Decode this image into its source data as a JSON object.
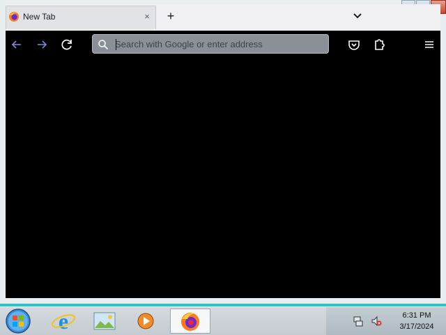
{
  "browser": {
    "tab": {
      "title": "New Tab",
      "close_glyph": "×"
    },
    "new_tab_glyph": "+",
    "address_bar": {
      "placeholder": "Search with Google or enter address",
      "value": ""
    },
    "icons": {
      "favicon": "firefox-icon",
      "back": "back-arrow-icon",
      "forward": "forward-arrow-icon",
      "reload": "reload-icon",
      "search": "search-icon",
      "pocket": "pocket-icon",
      "extensions": "puzzle-icon",
      "menu": "hamburger-menu-icon",
      "tab_list": "chevron-down-icon"
    }
  },
  "window_controls": [
    "minimize",
    "maximize",
    "close"
  ],
  "taskbar": {
    "start": "windows-start-icon",
    "apps": [
      "internet-explorer-icon",
      "image-viewer-icon",
      "media-player-icon",
      "firefox-icon"
    ],
    "tray": {
      "time": "6:31 PM",
      "date": "3/17/2024"
    }
  }
}
